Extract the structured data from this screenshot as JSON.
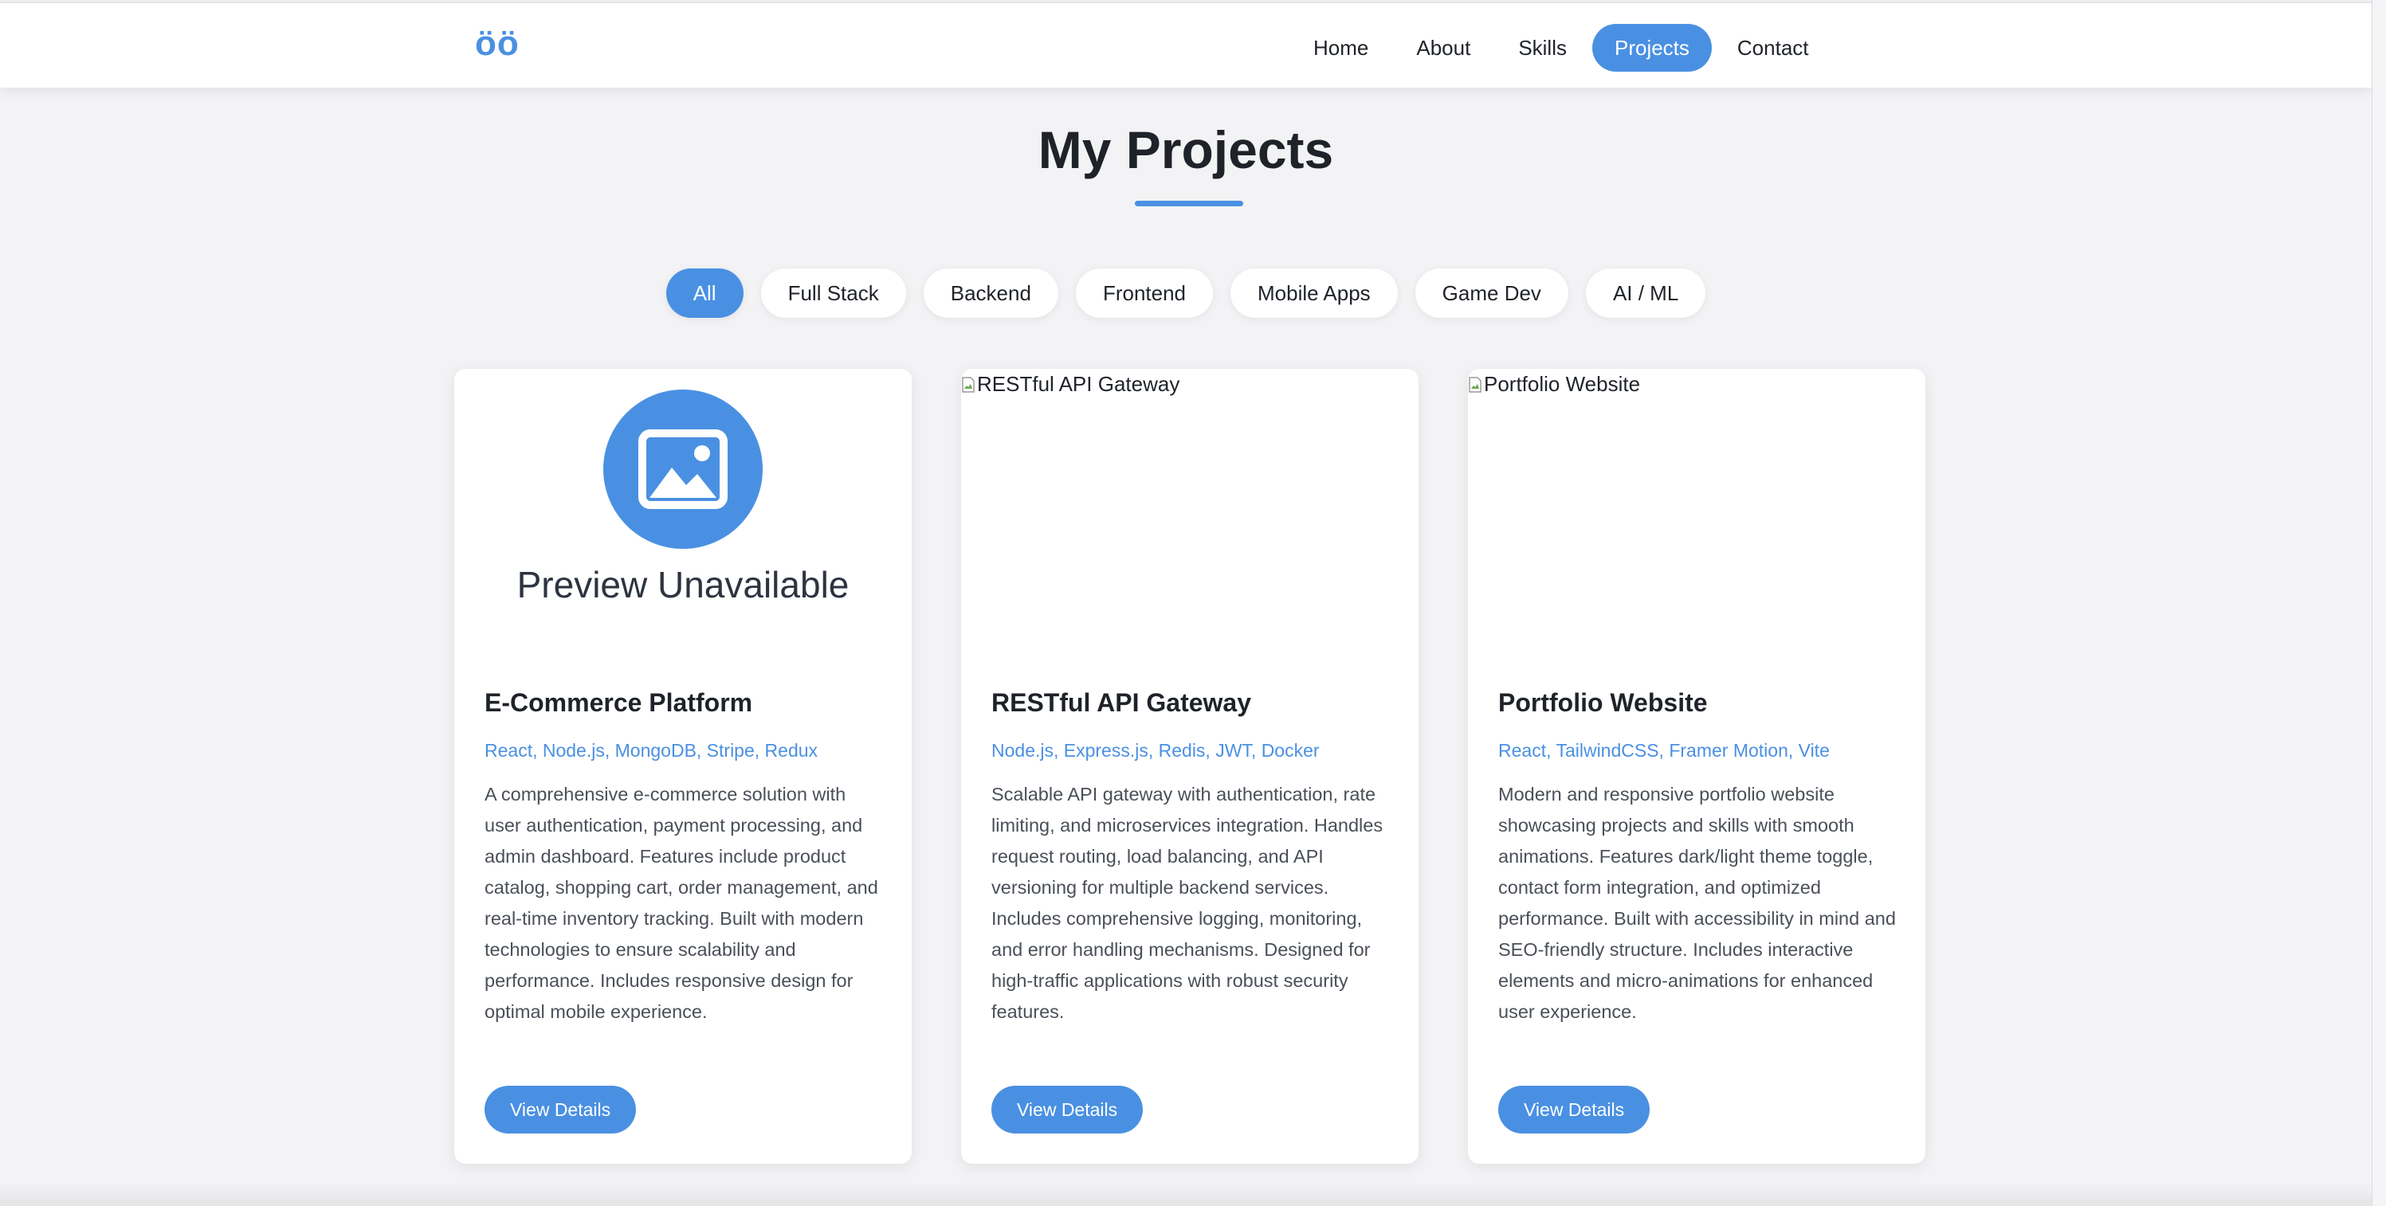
{
  "nav": {
    "logo": "öö",
    "links": [
      {
        "label": "Home"
      },
      {
        "label": "About"
      },
      {
        "label": "Skills"
      },
      {
        "label": "Projects",
        "active": true
      },
      {
        "label": "Contact"
      }
    ]
  },
  "section": {
    "title": "My Projects"
  },
  "filters": [
    {
      "label": "All",
      "active": true
    },
    {
      "label": "Full Stack"
    },
    {
      "label": "Backend"
    },
    {
      "label": "Frontend"
    },
    {
      "label": "Mobile Apps"
    },
    {
      "label": "Game Dev"
    },
    {
      "label": "AI / ML"
    }
  ],
  "projects": [
    {
      "image_alt": "",
      "preview_text": "Preview Unavailable",
      "title": "E-Commerce Platform",
      "tech": "React, Node.js, MongoDB, Stripe, Redux",
      "description": "A comprehensive e-commerce solution with user authentication, payment processing, and admin dashboard. Features include product catalog, shopping cart, order management, and real-time inventory tracking. Built with modern technologies to ensure scalability and performance. Includes responsive design for optimal mobile experience.",
      "button": "View Details"
    },
    {
      "image_alt": "RESTful API Gateway",
      "title": "RESTful API Gateway",
      "tech": "Node.js, Express.js, Redis, JWT, Docker",
      "description": "Scalable API gateway with authentication, rate limiting, and microservices integration. Handles request routing, load balancing, and API versioning for multiple backend services. Includes comprehensive logging, monitoring, and error handling mechanisms. Designed for high-traffic applications with robust security features.",
      "button": "View Details"
    },
    {
      "image_alt": "Portfolio Website",
      "title": "Portfolio Website",
      "tech": "React, TailwindCSS, Framer Motion, Vite",
      "description": "Modern and responsive portfolio website showcasing projects and skills with smooth animations. Features dark/light theme toggle, contact form integration, and optimized performance. Built with accessibility in mind and SEO-friendly structure. Includes interactive elements and micro-animations for enhanced user experience.",
      "button": "View Details"
    }
  ],
  "colors": {
    "accent": "#4a90e2",
    "background": "#f3f3f5",
    "card": "#ffffff",
    "text": "#1f2329"
  }
}
